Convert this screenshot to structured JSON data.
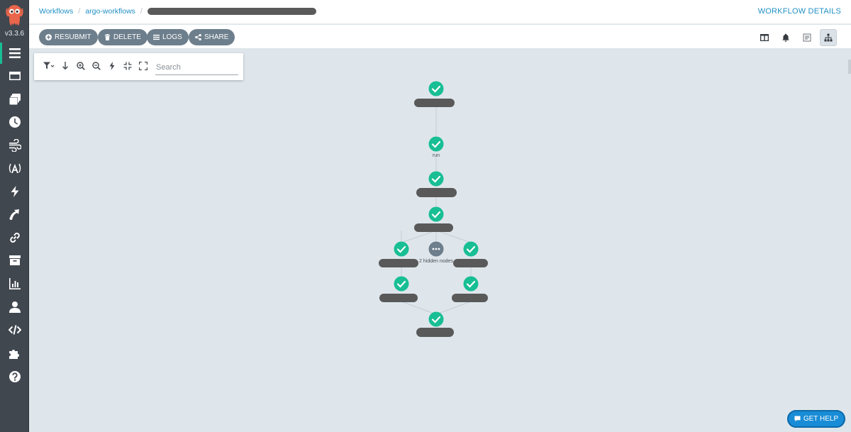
{
  "app": {
    "version": "v3.3.6",
    "page_title": "WORKFLOW DETAILS"
  },
  "breadcrumb": {
    "items": [
      "Workflows",
      "argo-workflows"
    ]
  },
  "sidebar": {
    "items": [
      {
        "icon": "workflows-icon",
        "active": true
      },
      {
        "icon": "workflow-templates-icon"
      },
      {
        "icon": "cluster-workflow-templates-icon"
      },
      {
        "icon": "cron-workflows-icon"
      },
      {
        "icon": "event-flow-icon"
      },
      {
        "icon": "event-sources-icon"
      },
      {
        "icon": "sensors-icon"
      },
      {
        "icon": "event-bus-icon"
      },
      {
        "icon": "links-icon"
      },
      {
        "icon": "archived-workflows-icon"
      },
      {
        "icon": "reports-icon"
      },
      {
        "icon": "user-icon"
      },
      {
        "icon": "api-docs-icon"
      },
      {
        "icon": "plugins-icon"
      },
      {
        "icon": "help-icon"
      }
    ]
  },
  "toolbar": {
    "resubmit_label": "RESUBMIT",
    "delete_label": "DELETE",
    "logs_label": "LOGS",
    "share_label": "SHARE",
    "view_icons": [
      "split-view-icon",
      "bell-icon",
      "summary-icon",
      "graph-view-icon"
    ]
  },
  "graph_toolbar": {
    "search_placeholder": "Search",
    "icons": [
      "filter-icon",
      "arrow-down-icon",
      "zoom-in-icon",
      "zoom-out-icon",
      "lightning-icon",
      "collapse-icon",
      "expand-icon"
    ]
  },
  "graph": {
    "status_color": "#18be94",
    "hidden_color": "#6d7e8c",
    "nodes": [
      {
        "id": "n1",
        "label": "",
        "status": "succeeded",
        "redacted": true
      },
      {
        "id": "n2",
        "label": "run",
        "status": "succeeded",
        "redacted": false
      },
      {
        "id": "n3",
        "label": "",
        "status": "succeeded",
        "redacted": true
      },
      {
        "id": "n4",
        "label": "",
        "status": "succeeded",
        "redacted": true
      },
      {
        "id": "n5",
        "label": "",
        "status": "succeeded",
        "redacted": true
      },
      {
        "id": "n6",
        "label": "2 hidden nodes",
        "status": "hidden",
        "redacted": false
      },
      {
        "id": "n7",
        "label": "",
        "status": "succeeded",
        "redacted": true
      },
      {
        "id": "n8",
        "label": "",
        "status": "succeeded",
        "redacted": true
      },
      {
        "id": "n9",
        "label": "",
        "status": "succeeded",
        "redacted": true
      },
      {
        "id": "n10",
        "label": "",
        "status": "succeeded",
        "redacted": true
      }
    ]
  },
  "help": {
    "label": "GET HELP"
  }
}
